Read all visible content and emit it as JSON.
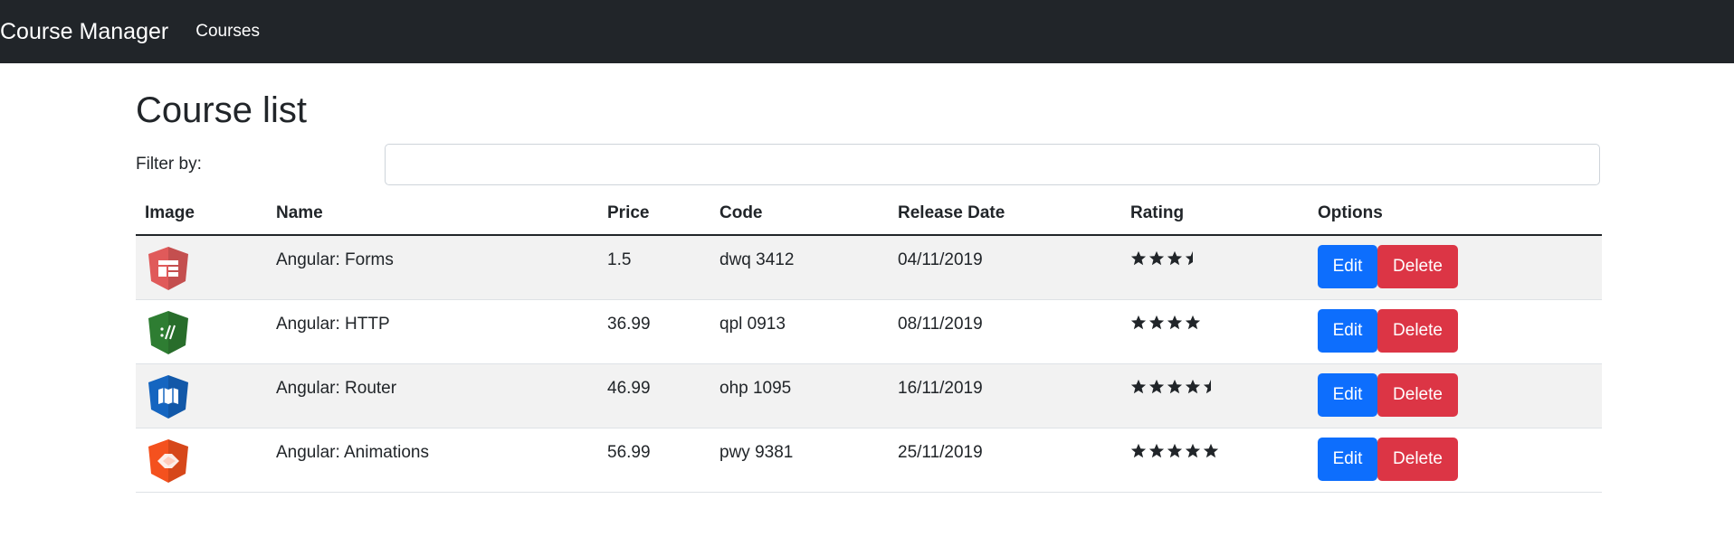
{
  "navbar": {
    "brand": "Course Manager",
    "link": "Courses"
  },
  "main": {
    "title": "Course list",
    "filter": {
      "label": "Filter by:",
      "value": "",
      "placeholder": ""
    },
    "columns": [
      "Image",
      "Name",
      "Price",
      "Code",
      "Release Date",
      "Rating",
      "Options"
    ],
    "courses": [
      {
        "icon": "forms-icon",
        "color": "#e05a5a",
        "name": "Angular: Forms",
        "price": "1.5",
        "code": "dwq 3412",
        "date": "04/11/2019",
        "rating": 3.5,
        "edit": "Edit",
        "delete": "Delete"
      },
      {
        "icon": "http-icon",
        "color": "#2e7d32",
        "name": "Angular: HTTP",
        "price": "36.99",
        "code": "qpl 0913",
        "date": "08/11/2019",
        "rating": 4,
        "edit": "Edit",
        "delete": "Delete"
      },
      {
        "icon": "router-icon",
        "color": "#1565c0",
        "name": "Angular: Router",
        "price": "46.99",
        "code": "ohp 1095",
        "date": "16/11/2019",
        "rating": 4.5,
        "edit": "Edit",
        "delete": "Delete"
      },
      {
        "icon": "animations-icon",
        "color": "#f4511e",
        "name": "Angular: Animations",
        "price": "56.99",
        "code": "pwy 9381",
        "date": "25/11/2019",
        "rating": 5,
        "edit": "Edit",
        "delete": "Delete"
      }
    ]
  },
  "colors": {
    "navbar": "#212529",
    "edit": "#0d6efd",
    "delete": "#dc3545",
    "stripe": "#f2f2f2"
  }
}
